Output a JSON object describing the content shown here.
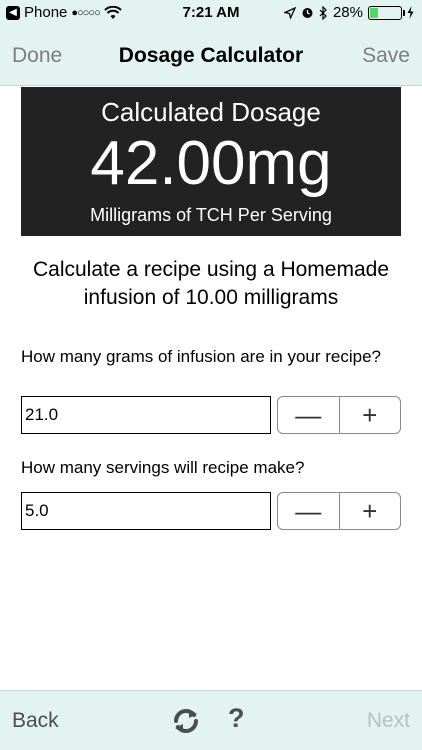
{
  "status_bar": {
    "carrier": "Phone",
    "signal_dots": "●○○○○",
    "time": "7:21 AM",
    "battery_percent": "28%",
    "battery_level": 0.28
  },
  "nav": {
    "left_label": "Done",
    "title": "Dosage Calculator",
    "right_label": "Save"
  },
  "dosage": {
    "title": "Calculated Dosage",
    "value": "42.00mg",
    "subtitle": "Milligrams of TCH Per Serving"
  },
  "recipe_heading": "Calculate a recipe using a Homemade infusion of 10.00 milligrams",
  "questions": [
    {
      "label": "How many grams of infusion are in your recipe?",
      "value": "21.0"
    },
    {
      "label": "How many servings will recipe make?",
      "value": "5.0"
    }
  ],
  "stepper": {
    "minus": "—",
    "plus": "+"
  },
  "toolbar": {
    "back_label": "Back",
    "help_label": "?",
    "next_label": "Next"
  },
  "colors": {
    "bar_background": "#e3f3ef",
    "panel_background": "#222222",
    "battery_fill": "#4cd964",
    "disabled_text": "#b6c3c0"
  },
  "icons": [
    "back-to-app-icon",
    "wifi-icon",
    "location-icon",
    "alarm-icon",
    "bluetooth-icon",
    "battery-icon",
    "charging-icon",
    "refresh-icon"
  ]
}
